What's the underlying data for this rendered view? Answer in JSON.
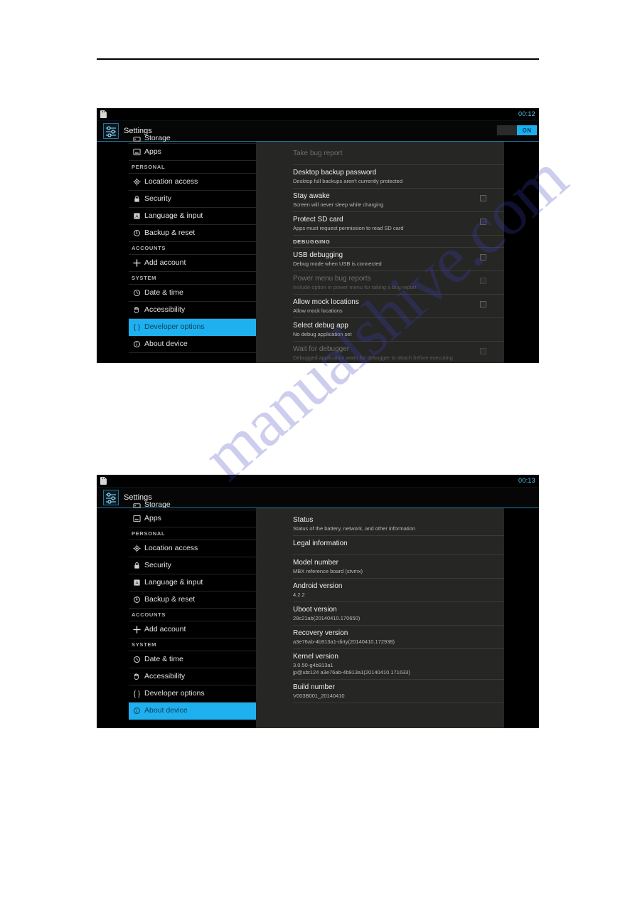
{
  "page": {
    "watermark": "manualshive.com"
  },
  "screenshot_1": {
    "statusbar": {
      "icon": "sd-card-icon",
      "clock": "00:12"
    },
    "actionbar": {
      "icon": "settings-sliders-icon",
      "title": "Settings",
      "toggle_on_label": "ON"
    },
    "sidebar": {
      "partial_item": "Storage",
      "items": [
        {
          "type": "item",
          "icon": "apps-icon",
          "label": "Apps"
        },
        {
          "type": "header",
          "label": "PERSONAL"
        },
        {
          "type": "item",
          "icon": "location-icon",
          "label": "Location access"
        },
        {
          "type": "item",
          "icon": "lock-icon",
          "label": "Security"
        },
        {
          "type": "item",
          "icon": "language-icon",
          "label": "Language & input"
        },
        {
          "type": "item",
          "icon": "backup-reset-icon",
          "label": "Backup & reset"
        },
        {
          "type": "header",
          "label": "ACCOUNTS"
        },
        {
          "type": "item",
          "icon": "plus-icon",
          "label": "Add account"
        },
        {
          "type": "header",
          "label": "SYSTEM"
        },
        {
          "type": "item",
          "icon": "clock-icon",
          "label": "Date & time"
        },
        {
          "type": "item",
          "icon": "accessibility-hand-icon",
          "label": "Accessibility"
        },
        {
          "type": "item",
          "icon": "braces-icon",
          "label": "Developer options",
          "selected": true
        },
        {
          "type": "item",
          "icon": "info-circle-icon",
          "label": "About device"
        }
      ]
    },
    "panel": {
      "rows": [
        {
          "type": "pref",
          "title": "Take bug report",
          "sub": "",
          "disabled": true,
          "checkbox": false
        },
        {
          "type": "pref",
          "title": "Desktop backup password",
          "sub": "Desktop full backups aren't currently protected",
          "disabled": false,
          "checkbox": false
        },
        {
          "type": "pref",
          "title": "Stay awake",
          "sub": "Screen will never sleep while charging",
          "disabled": false,
          "checkbox": true
        },
        {
          "type": "pref",
          "title": "Protect SD card",
          "sub": "Apps must request permission to read SD card",
          "disabled": false,
          "checkbox": true
        },
        {
          "type": "header",
          "label": "DEBUGGING"
        },
        {
          "type": "pref",
          "title": "USB debugging",
          "sub": "Debug mode when USB is connected",
          "disabled": false,
          "checkbox": true
        },
        {
          "type": "pref",
          "title": "Power menu bug reports",
          "sub": "Include option in power menu for taking a bug report",
          "disabled": true,
          "checkbox": true
        },
        {
          "type": "pref",
          "title": "Allow mock locations",
          "sub": "Allow mock locations",
          "disabled": false,
          "checkbox": true
        },
        {
          "type": "pref",
          "title": "Select debug app",
          "sub": "No debug application set",
          "disabled": false,
          "checkbox": false
        },
        {
          "type": "pref",
          "title": "Wait for debugger",
          "sub": "Debugged application waits for debugger to attach before executing",
          "disabled": true,
          "checkbox": true
        }
      ]
    }
  },
  "screenshot_2": {
    "statusbar": {
      "icon": "sd-card-icon",
      "clock": "00:13"
    },
    "actionbar": {
      "icon": "settings-sliders-icon",
      "title": "Settings"
    },
    "sidebar": {
      "partial_item": "Storage",
      "items": [
        {
          "type": "item",
          "icon": "apps-icon",
          "label": "Apps"
        },
        {
          "type": "header",
          "label": "PERSONAL"
        },
        {
          "type": "item",
          "icon": "location-icon",
          "label": "Location access"
        },
        {
          "type": "item",
          "icon": "lock-icon",
          "label": "Security"
        },
        {
          "type": "item",
          "icon": "language-icon",
          "label": "Language & input"
        },
        {
          "type": "item",
          "icon": "backup-reset-icon",
          "label": "Backup & reset"
        },
        {
          "type": "header",
          "label": "ACCOUNTS"
        },
        {
          "type": "item",
          "icon": "plus-icon",
          "label": "Add account"
        },
        {
          "type": "header",
          "label": "SYSTEM"
        },
        {
          "type": "item",
          "icon": "clock-icon",
          "label": "Date & time"
        },
        {
          "type": "item",
          "icon": "accessibility-hand-icon",
          "label": "Accessibility"
        },
        {
          "type": "item",
          "icon": "braces-icon",
          "label": "Developer options"
        },
        {
          "type": "item",
          "icon": "info-circle-icon",
          "label": "About device",
          "selected": true
        }
      ]
    },
    "panel": {
      "rows": [
        {
          "type": "pref",
          "title": "Status",
          "sub": "Status of the battery, network, and other information"
        },
        {
          "type": "pref",
          "title": "Legal information",
          "sub": ""
        },
        {
          "type": "pref",
          "title": "Model number",
          "sub": "MBX reference board (stvmx)"
        },
        {
          "type": "pref",
          "title": "Android version",
          "sub": "4.2.2"
        },
        {
          "type": "pref",
          "title": "Uboot version",
          "sub": "28c21ab(20140410.170650)"
        },
        {
          "type": "pref",
          "title": "Recovery version",
          "sub": "a3e76ab-4b913a1-dirty(20140410.172938)"
        },
        {
          "type": "pref",
          "title": "Kernel version",
          "sub": "3.0.50-g4b913a1\njp@ubt124 a3e76ab-4b913a1(20140410.171633)"
        },
        {
          "type": "pref",
          "title": "Build number",
          "sub": "V003B001_20140410"
        }
      ]
    }
  },
  "colors": {
    "accent": "#1eb0ef",
    "panel_bg": "#262625",
    "sidebar_bg": "#000000",
    "clock": "#56c8ef"
  }
}
